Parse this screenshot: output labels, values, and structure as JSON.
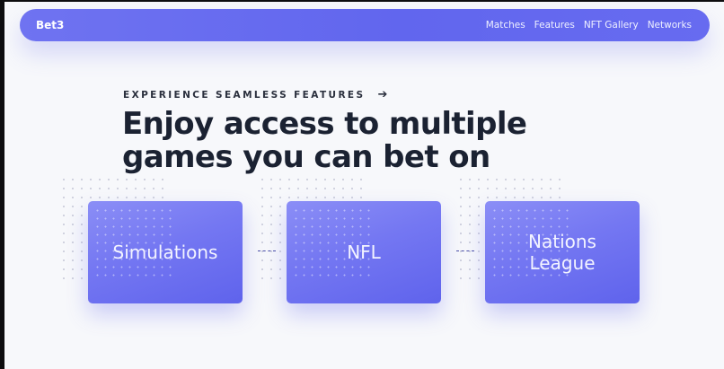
{
  "nav": {
    "brand": "Bet3",
    "links": [
      "Matches",
      "Features",
      "NFT Gallery",
      "Networks"
    ]
  },
  "hero": {
    "kicker": "EXPERIENCE SEAMLESS FEATURES",
    "headline_line1": "Enjoy access to multiple",
    "headline_line2": "games you can bet on"
  },
  "cards": [
    {
      "label": "Simulations"
    },
    {
      "label": "NFL"
    },
    {
      "label": "Nations League"
    }
  ],
  "colors": {
    "accent": "#6166ee",
    "text_dark": "#1b2232",
    "background": "#f7f8fb"
  },
  "icons": {
    "kicker_arrow": "arrow-right-icon"
  }
}
